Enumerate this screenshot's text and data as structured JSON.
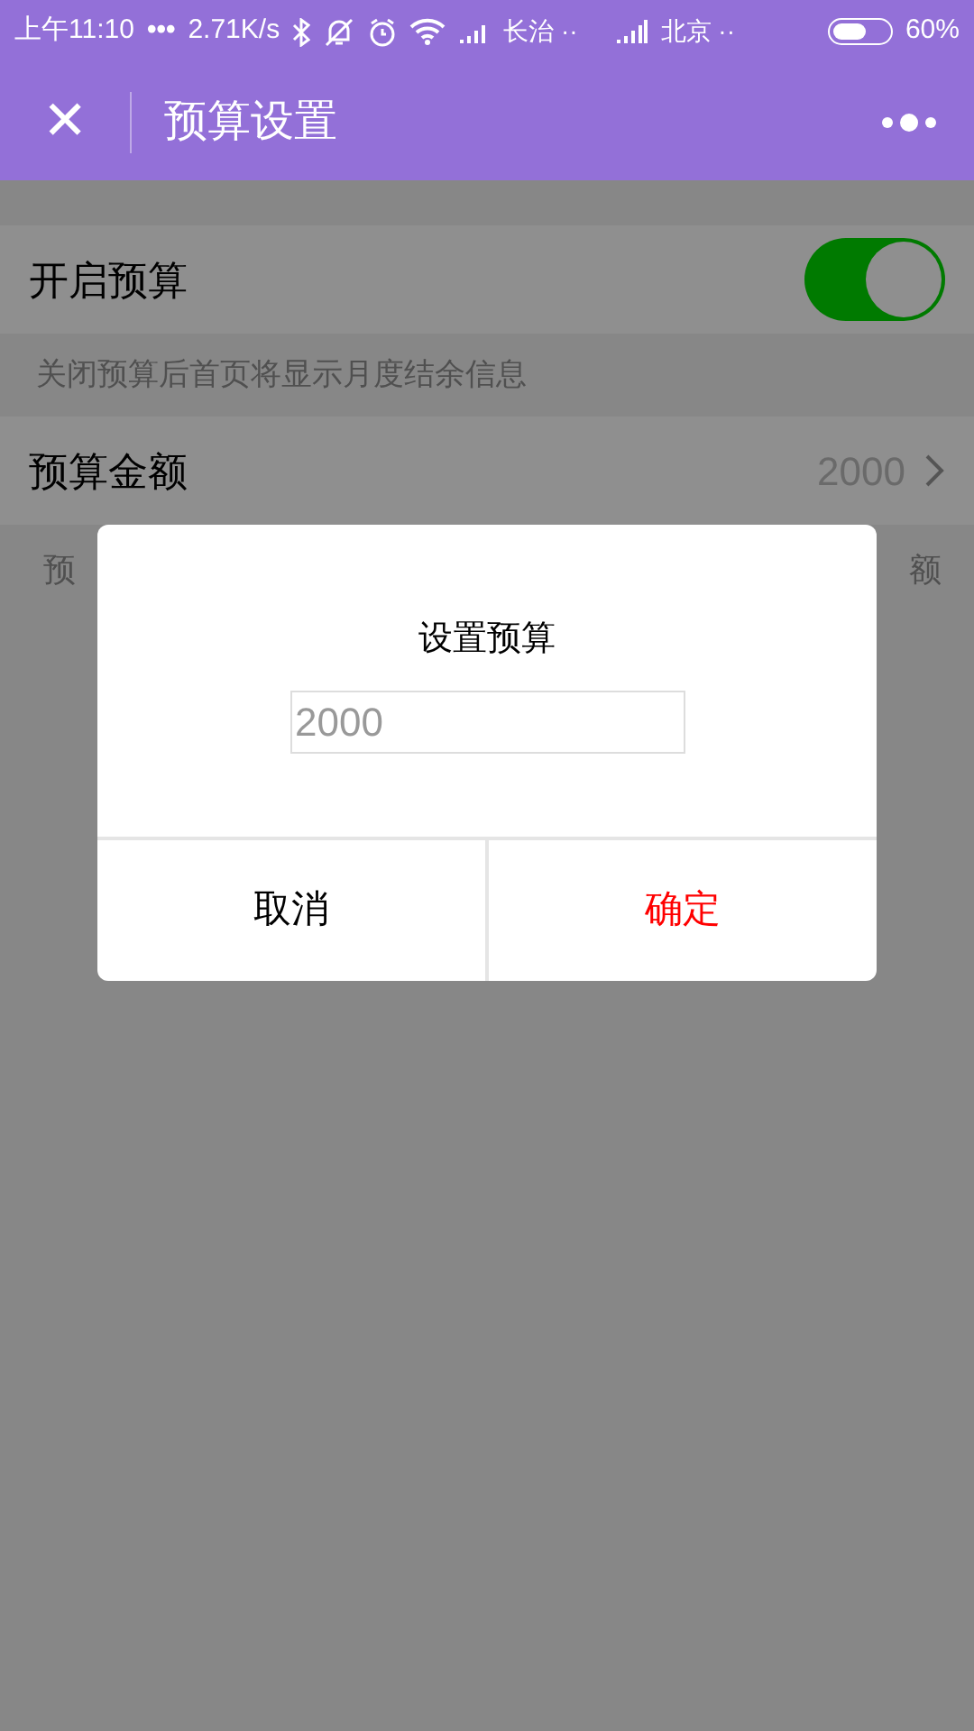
{
  "status_bar": {
    "time": "上午11:10",
    "dots": "•••",
    "speed": "2.71K/s",
    "carrier_1": "长治 ··",
    "carrier_2": "北京 ··",
    "battery": "60%"
  },
  "header": {
    "close": "✕",
    "title": "预算设置"
  },
  "settings": [
    {
      "kind": "toggle",
      "label": "开启预算",
      "on": true
    },
    {
      "kind": "hint",
      "text": "关闭预算后首页将显示月度结余信息"
    },
    {
      "kind": "value",
      "label": "预算金额",
      "value": "2000"
    }
  ],
  "hint_visible": {
    "left": "预",
    "right": "额"
  },
  "dialog": {
    "title": "设置预算",
    "input_value": "2000",
    "buttons": [
      {
        "label": "取消",
        "kind": "cancel"
      },
      {
        "label": "确定",
        "kind": "confirm"
      }
    ]
  }
}
